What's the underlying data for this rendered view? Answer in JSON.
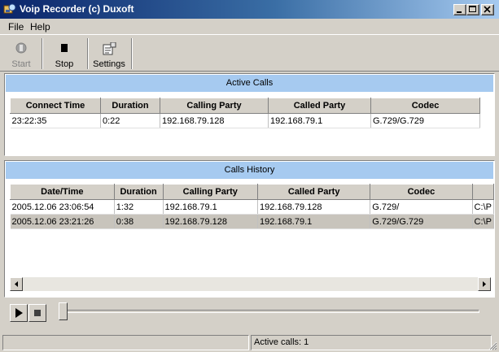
{
  "window": {
    "title": "Voip Recorder (c) Duxoft"
  },
  "menu": {
    "items": [
      "File",
      "Help"
    ]
  },
  "toolbar": {
    "start_label": "Start",
    "stop_label": "Stop",
    "settings_label": "Settings"
  },
  "active_calls": {
    "title": "Active Calls",
    "columns": [
      "Connect Time",
      "Duration",
      "Calling Party",
      "Called Party",
      "Codec"
    ],
    "rows": [
      [
        "23:22:35",
        "0:22",
        "192.168.79.128",
        "192.168.79.1",
        "G.729/G.729"
      ]
    ]
  },
  "calls_history": {
    "title": "Calls History",
    "columns": [
      "Date/Time",
      "Duration",
      "Calling Party",
      "Called Party",
      "Codec",
      ""
    ],
    "rows": [
      [
        "2005.12.06 23:06:54",
        "1:32",
        "192.168.79.1",
        "192.168.79.128",
        "G.729/",
        "C:\\P"
      ],
      [
        "2005.12.06 23:21:26",
        "0:38",
        "192.168.79.128",
        "192.168.79.1",
        "G.729/G.729",
        "C:\\P"
      ]
    ],
    "selected_row": 1
  },
  "status": {
    "pane1": "",
    "pane2": "Active calls: 1"
  },
  "colors": {
    "panel_header": "#a6caf0",
    "title_bar_start": "#0a246a",
    "title_bar_end": "#a6caf0"
  }
}
